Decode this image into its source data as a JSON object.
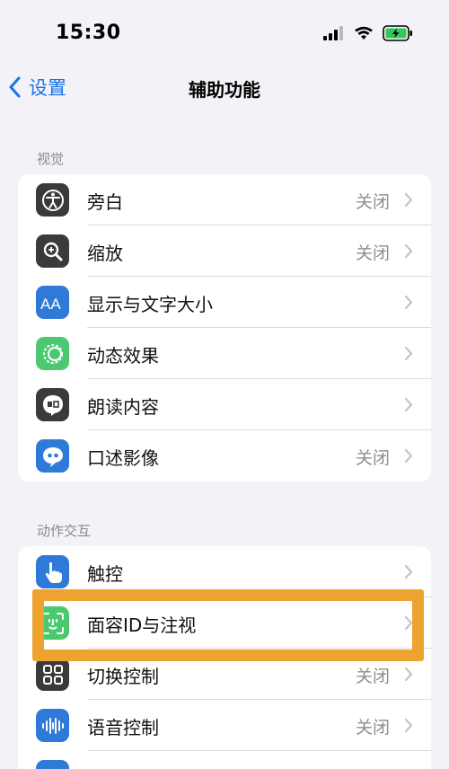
{
  "status": {
    "time": "15:30"
  },
  "nav": {
    "back_label": "设置",
    "title": "辅助功能"
  },
  "sections": [
    {
      "header": "视觉",
      "items": [
        {
          "label": "旁白",
          "value": "关闭",
          "icon": "voiceover-icon",
          "color": "#3a3a3c"
        },
        {
          "label": "缩放",
          "value": "关闭",
          "icon": "zoom-icon",
          "color": "#3a3a3c"
        },
        {
          "label": "显示与文字大小",
          "value": "",
          "icon": "text-size-icon",
          "color": "#2f7ad8"
        },
        {
          "label": "动态效果",
          "value": "",
          "icon": "motion-icon",
          "color": "#4cc870"
        },
        {
          "label": "朗读内容",
          "value": "",
          "icon": "spoken-content-icon",
          "color": "#3a3a3c"
        },
        {
          "label": "口述影像",
          "value": "关闭",
          "icon": "audio-description-icon",
          "color": "#2f7ad8"
        }
      ]
    },
    {
      "header": "动作交互",
      "items": [
        {
          "label": "触控",
          "value": "",
          "icon": "touch-icon",
          "color": "#2f7ad8"
        },
        {
          "label": "面容ID与注视",
          "value": "",
          "icon": "face-id-icon",
          "color": "#4cc870"
        },
        {
          "label": "切换控制",
          "value": "关闭",
          "icon": "switch-control-icon",
          "color": "#3a3a3c"
        },
        {
          "label": "语音控制",
          "value": "关闭",
          "icon": "voice-control-icon",
          "color": "#2f7ad8"
        }
      ]
    }
  ]
}
